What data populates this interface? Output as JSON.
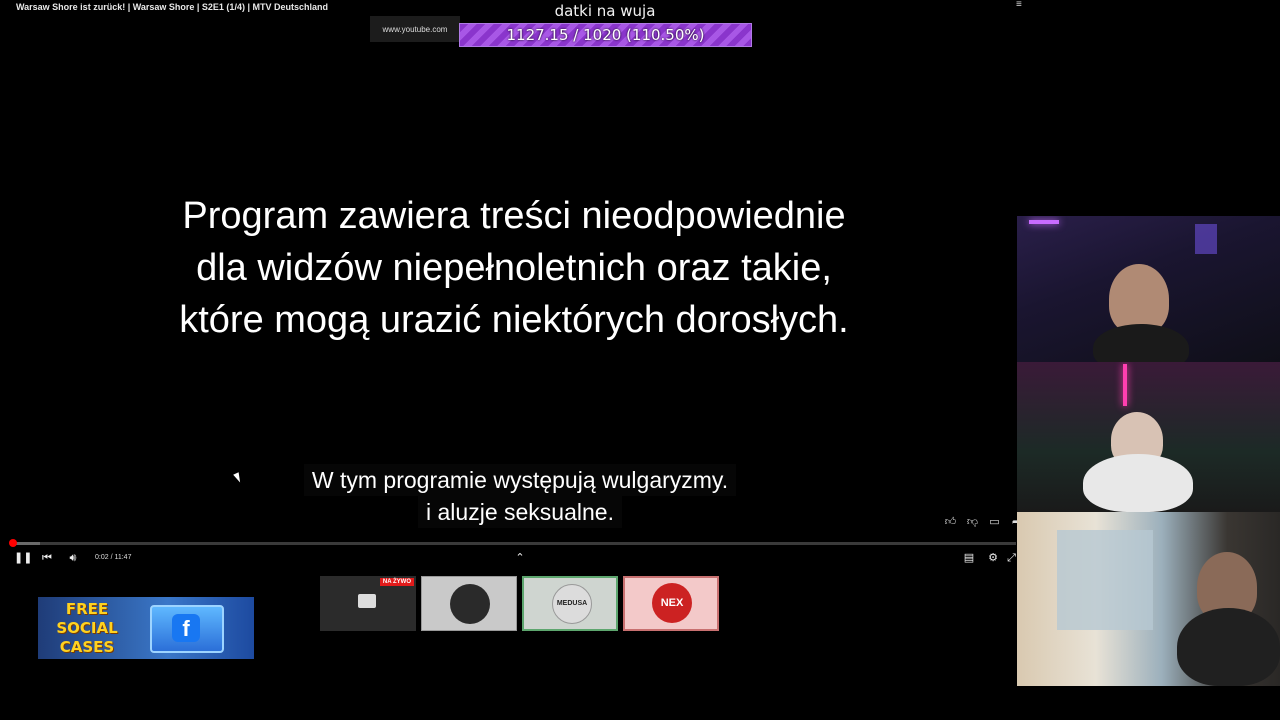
{
  "video": {
    "title": "Warsaw Shore ist zurück! | Warsaw Shore | S2E1 (1/4) | MTV Deutschland",
    "url_chip": "www.youtube.com",
    "warning_lines": [
      "Program zawiera treści nieodpowiednie",
      "dla widzów niepełnoletnich oraz takie,",
      "które mogą urazić niektórych dorosłych."
    ],
    "subtitle_lines": [
      "W tym programie występują wulgaryzmy.",
      "i aluzje seksualne."
    ],
    "time_display": "0:02 / 11:47",
    "progress_fraction": 0.003,
    "buffer_fraction": 0.03
  },
  "donation_goal": {
    "title": "datki na wuja",
    "text": "1127.15 / 1020 (110.50%)",
    "fraction": 1.0
  },
  "thumbnails": [
    {
      "badge": "NA ŻYWO"
    },
    {
      "badge": ""
    },
    {
      "label": "MEDUSA"
    },
    {
      "label": "NEX"
    }
  ],
  "promo": {
    "line1": "FREE",
    "line2": "SOCIAL",
    "line3": "CASES",
    "icon": "f"
  },
  "icons": {
    "playlist": "playlist-icon",
    "like": "thumbs-up-icon",
    "dislike": "thumbs-down-icon",
    "chat": "chat-icon",
    "share": "share-icon",
    "play_pause": "pause-icon",
    "previous": "previous-icon",
    "volume": "volume-icon",
    "chevron": "chevron-up-icon",
    "captions": "captions-icon",
    "settings": "settings-icon"
  },
  "colors": {
    "progress": "#ff0000",
    "donation_bar": "#8a35cc",
    "live_badge": "#e21b1b"
  }
}
